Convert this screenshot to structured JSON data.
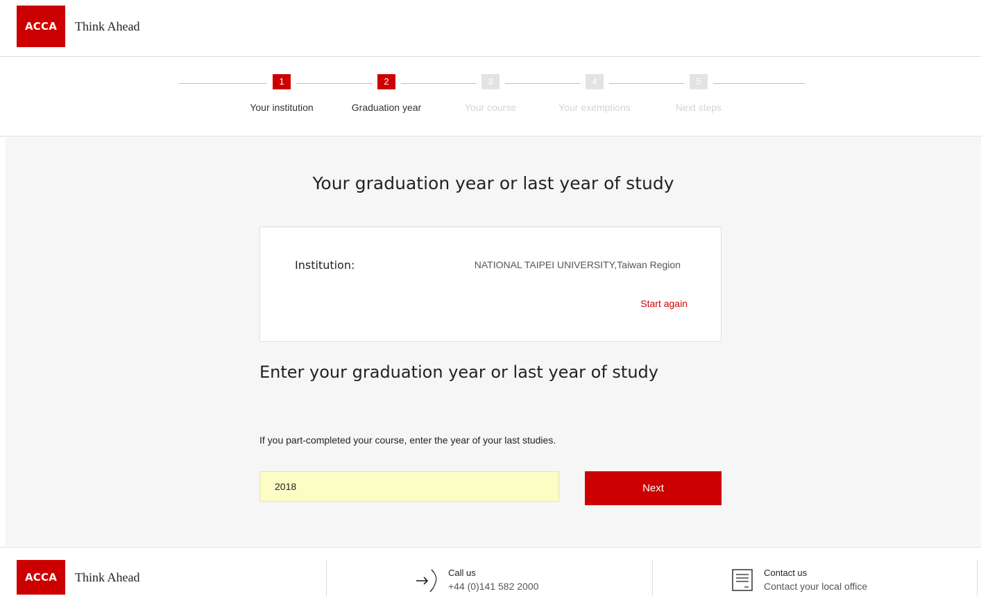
{
  "brand": {
    "logo_text": "ACCA",
    "tagline": "Think Ahead"
  },
  "steps": [
    {
      "number": "1",
      "label": "Your institution",
      "active": true
    },
    {
      "number": "2",
      "label": "Graduation year",
      "active": true
    },
    {
      "number": "3",
      "label": "Your course",
      "active": false
    },
    {
      "number": "4",
      "label": "Your exemptions",
      "active": false
    },
    {
      "number": "5",
      "label": "Next steps",
      "active": false
    }
  ],
  "main": {
    "title": "Your graduation year or last year of study",
    "institution_label": "Institution:",
    "institution_value": "NATIONAL TAIPEI UNIVERSITY,Taiwan Region",
    "start_again": "Start again",
    "subtitle": "Enter your graduation year or last year of study",
    "help_text": "If you part-completed your course, enter the year of your last studies.",
    "year_value": "2018",
    "next_label": "Next"
  },
  "footer": {
    "call_title": "Call us",
    "call_number": "+44 (0)141 582 2000",
    "contact_title": "Contact us",
    "contact_sub": "Contact your local office"
  }
}
